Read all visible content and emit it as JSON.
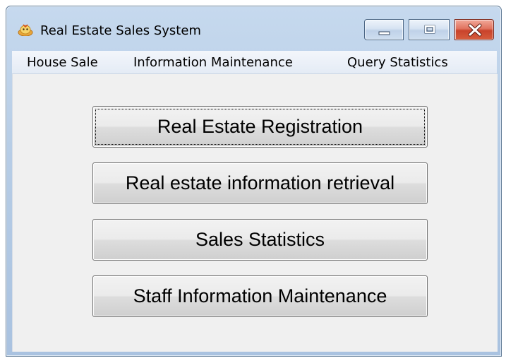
{
  "window": {
    "title": "Real Estate Sales System",
    "icon": "app-icon"
  },
  "title_controls": {
    "minimize": "minimize-icon",
    "maximize": "maximize-icon",
    "close": "close-icon"
  },
  "menu": {
    "items": [
      {
        "label": "House Sale"
      },
      {
        "label": "Information Maintenance"
      },
      {
        "label": "Query Statistics"
      }
    ]
  },
  "buttons": {
    "items": [
      {
        "label": "Real Estate Registration",
        "focused": true
      },
      {
        "label": "Real estate information retrieval"
      },
      {
        "label": "Sales Statistics"
      },
      {
        "label": "Staff Information Maintenance"
      }
    ]
  },
  "colors": {
    "title_bar": "#b7cde6",
    "close_button": "#c9432b",
    "client_bg": "#f0f0f0"
  }
}
